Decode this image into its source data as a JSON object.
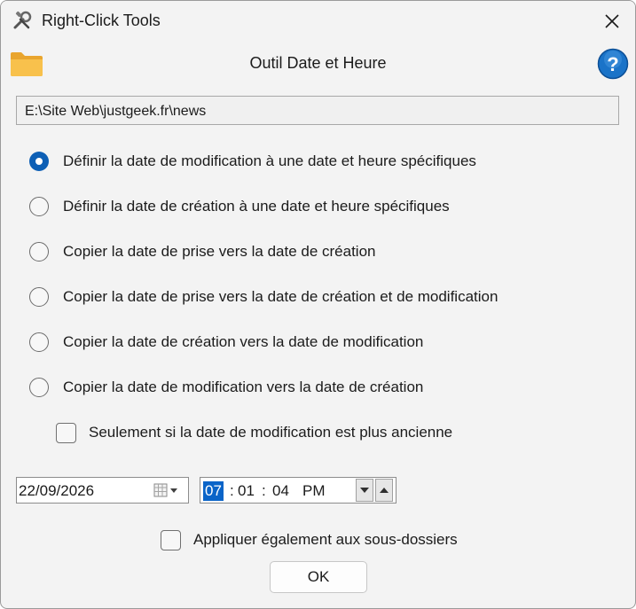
{
  "window": {
    "title": "Right-Click Tools",
    "app_icon": "tools-icon",
    "close_icon": "close-icon"
  },
  "header": {
    "folder_icon": "folder-icon",
    "title": "Outil Date et Heure",
    "help_icon": "help-icon"
  },
  "path": {
    "value": "E:\\Site Web\\justgeek.fr\\news"
  },
  "options": [
    {
      "label": "Définir la date de modification à une date et heure spécifiques",
      "checked": true
    },
    {
      "label": "Définir la date de création à une date et heure spécifiques",
      "checked": false
    },
    {
      "label": "Copier la date de prise vers la date de création",
      "checked": false
    },
    {
      "label": "Copier la date de prise vers la date de création et de modification",
      "checked": false
    },
    {
      "label": "Copier la date de création vers la date de modification",
      "checked": false
    },
    {
      "label": "Copier la date de modification vers la date de création",
      "checked": false
    }
  ],
  "only_if_older": {
    "label": "Seulement si la date de modification est plus ancienne",
    "checked": false
  },
  "date": {
    "value": "22/09/2026",
    "calendar_icon": "calendar-dropdown-icon"
  },
  "time": {
    "hour": "07",
    "sep1": ":",
    "minute": "01",
    "sep2": ":",
    "second": "04",
    "ampm": "PM",
    "selected_field": "hour"
  },
  "subfolders": {
    "label": "Appliquer également aux sous-dossiers",
    "checked": false
  },
  "ok_button": {
    "label": "OK"
  },
  "colors": {
    "accent": "#0d5fb5",
    "selection": "#0a64c8",
    "window_bg": "#f3f3f3",
    "help_blue": "#1a73c8",
    "folder": "#f5b83d"
  }
}
